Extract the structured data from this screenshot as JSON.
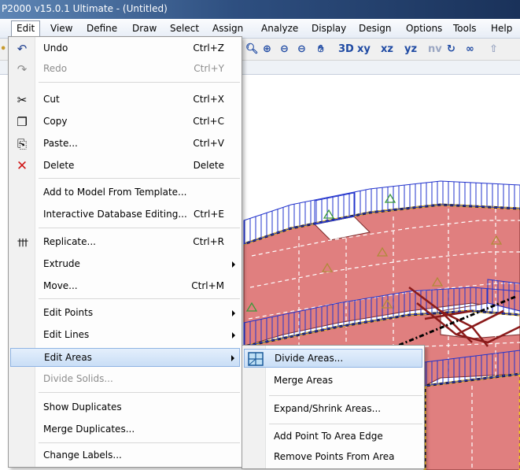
{
  "window": {
    "title": "P2000 v15.0.1 Ultimate  - (Untitled)"
  },
  "menubar": {
    "items": [
      "Edit",
      "View",
      "Define",
      "Draw",
      "Select",
      "Assign",
      "Analyze",
      "Display",
      "Design",
      "Options",
      "Tools",
      "Help"
    ],
    "active": "Edit"
  },
  "toolbar": {
    "view_labels": [
      "xy",
      "xz",
      "yz",
      "nv"
    ],
    "icon_3d": "3D"
  },
  "edit_menu": {
    "items": [
      {
        "label": "Undo",
        "shortcut": "Ctrl+Z",
        "icon": "undo-icon"
      },
      {
        "label": "Redo",
        "shortcut": "Ctrl+Y",
        "icon": "redo-icon",
        "disabled": true
      },
      {
        "label": "Cut",
        "shortcut": "Ctrl+X",
        "icon": "scissors-icon"
      },
      {
        "label": "Copy",
        "shortcut": "Ctrl+C",
        "icon": "copy-icon"
      },
      {
        "label": "Paste...",
        "shortcut": "Ctrl+V",
        "icon": "paste-icon"
      },
      {
        "label": "Delete",
        "shortcut": "Delete",
        "icon": "delete-x-icon"
      },
      {
        "label": "Add to Model From Template..."
      },
      {
        "label": "Interactive Database Editing...",
        "shortcut": "Ctrl+E"
      },
      {
        "label": "Replicate...",
        "shortcut": "Ctrl+R",
        "icon": "replicate-icon"
      },
      {
        "label": "Extrude",
        "submenu": true
      },
      {
        "label": "Move...",
        "shortcut": "Ctrl+M"
      },
      {
        "label": "Edit Points",
        "submenu": true
      },
      {
        "label": "Edit Lines",
        "submenu": true
      },
      {
        "label": "Edit Areas",
        "submenu": true,
        "highlighted": true
      },
      {
        "label": "Divide Solids...",
        "disabled": true
      },
      {
        "label": "Show Duplicates"
      },
      {
        "label": "Merge Duplicates..."
      },
      {
        "label": "Change Labels..."
      }
    ]
  },
  "edit_areas_submenu": {
    "items": [
      {
        "label": "Divide Areas...",
        "highlighted": true,
        "icon": "divide-areas-icon"
      },
      {
        "label": "Merge Areas"
      },
      {
        "label": "Expand/Shrink Areas..."
      },
      {
        "label": "Add Point To Area Edge"
      },
      {
        "label": "Remove Points From Area"
      }
    ]
  },
  "colors": {
    "slab_fill": "#e07f7f",
    "load_lines": "#2233cc",
    "edge_dash": "#f0c020",
    "menu_highlight": "#c9def6",
    "titlebar": "#2e4f80"
  }
}
